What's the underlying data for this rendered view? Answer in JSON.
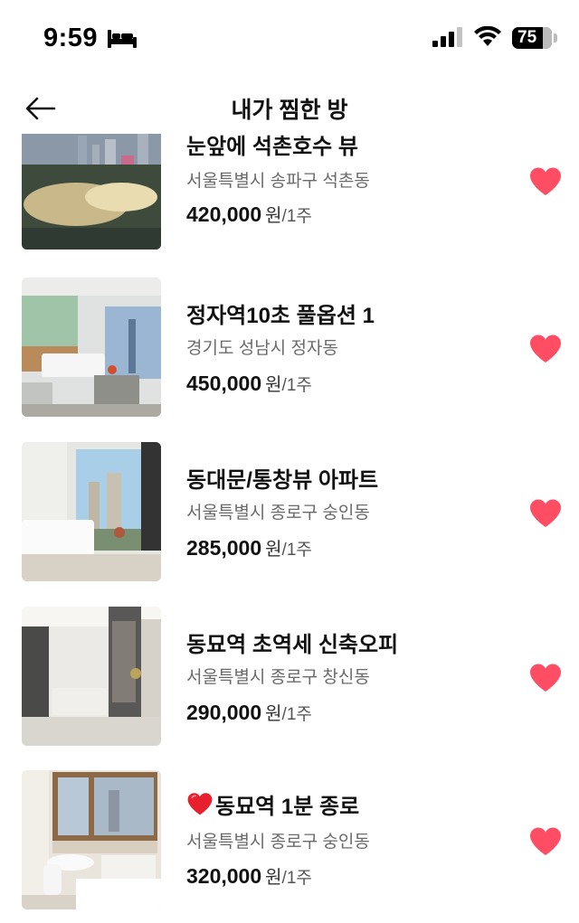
{
  "status_bar": {
    "time": "9:59",
    "battery": "75",
    "icons": [
      "bed-icon",
      "signal-icon",
      "wifi-icon",
      "battery-icon"
    ]
  },
  "header": {
    "title": "내가 찜한 방",
    "back_icon": "arrow-left-icon"
  },
  "listings": [
    {
      "name": "눈앞에 석촌호수 뷰",
      "address": "서울특별시 송파구 석촌동",
      "price": "420,000",
      "currency": "원",
      "period": "/1주",
      "favorite": true
    },
    {
      "name": "정자역10초 풀옵션 1",
      "address": "경기도 성남시 정자동",
      "price": "450,000",
      "currency": "원",
      "period": "/1주",
      "favorite": true
    },
    {
      "name": "동대문/통창뷰 아파트",
      "address": "서울특별시 종로구 숭인동",
      "price": "285,000",
      "currency": "원",
      "period": "/1주",
      "favorite": true
    },
    {
      "name": "동묘역 초역세 신축오피",
      "address": "서울특별시 종로구 창신동",
      "price": "290,000",
      "currency": "원",
      "period": "/1주",
      "favorite": true
    },
    {
      "name": "동묘역 1분 종로",
      "address": "서울특별시 종로구 숭인동",
      "price": "320,000",
      "currency": "원",
      "period": "/1주",
      "favorite": true,
      "name_prefix_icon": "red-heart-emoji-icon"
    }
  ],
  "colors": {
    "heart": "#ff4d63",
    "address_text": "#6b6b6b"
  }
}
